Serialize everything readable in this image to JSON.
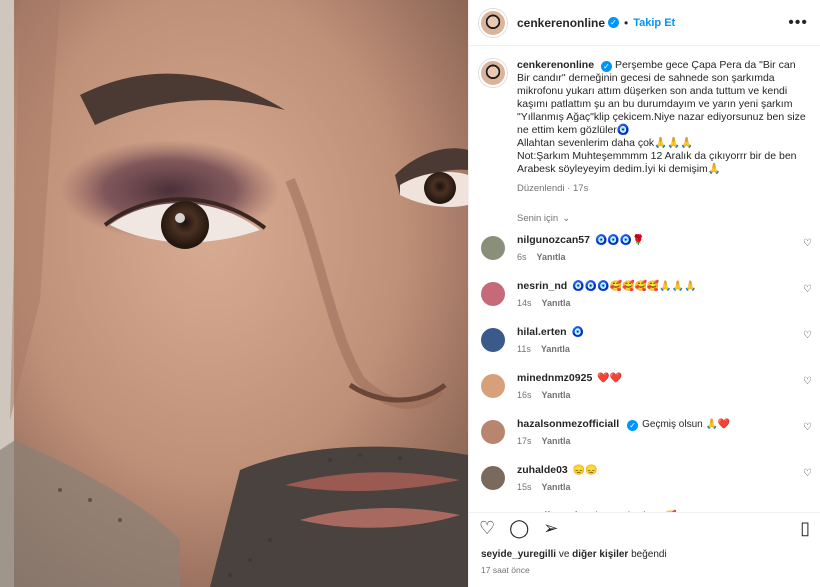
{
  "header": {
    "username": "cenkerenonline",
    "follow_label": "Takip Et",
    "more_label": "•••"
  },
  "caption": {
    "username": "cenkerenonline",
    "text": "Perşembe gece Çapa Pera da \"Bir can Bir candır\" derneğinin gecesi de sahnede son şarkımda mikrofonu yukarı attım düşerken son anda tuttum ve kendi kaşımı patlattım şu an bu durumdayım ve yarın yeni şarkım \"Yıllanmış Ağaç\"klip çekicem.Niye nazar ediyorsunuz ben size ne ettim kem gözlüler🧿",
    "line2": "Allahtan sevenlerim daha çok🙏🙏🙏",
    "line3": "Not:Şarkım Muhteşemmmm 12 Aralık da çıkıyorrr bir de ben Arabesk söyleyeyim dedim.İyi ki demişim🙏",
    "edited": "Düzenlendi",
    "age": "17s"
  },
  "for_you_label": "Senin için",
  "comments": [
    {
      "user": "nilgunozcan57",
      "text": "🧿🧿🧿🌹",
      "age": "6s",
      "reply": "Yanıtla",
      "color": "#8a8f7a"
    },
    {
      "user": "nesrin_nd",
      "text": "🧿🧿🧿🥰🥰🥰🥰🙏🙏🙏",
      "age": "14s",
      "reply": "Yanıtla",
      "color": "#c46a78"
    },
    {
      "user": "hilal.erten",
      "text": "🧿",
      "age": "11s",
      "reply": "Yanıtla",
      "color": "#3a5a8c"
    },
    {
      "user": "minednmz0925",
      "text": "❤️❤️",
      "age": "16s",
      "reply": "Yanıtla",
      "color": "#d8a07a"
    },
    {
      "user": "hazalsonmezofficiall",
      "text": "Geçmiş olsun 🙏❤️",
      "age": "17s",
      "reply": "Yanıtla",
      "color": "#b8866e"
    },
    {
      "user": "zuhalde03",
      "text": "😞😞",
      "age": "15s",
      "reply": "Yanıtla",
      "color": "#7a6a5e"
    },
    {
      "user": "tanselkutsal",
      "text": "Çok geçmiş olsun 🥰",
      "age": "",
      "reply": "",
      "color": "#5e5a52"
    }
  ],
  "liked_by": {
    "user": "seyide_yuregilli",
    "and": "ve",
    "others": "diğer kişiler",
    "suffix": "beğendi"
  },
  "post_time": "17 saat önce",
  "colors": {
    "accent": "#0095f6",
    "text": "#262626",
    "muted": "#737373"
  },
  "icons": [
    "heart-icon",
    "comment-icon",
    "share-icon",
    "bookmark-icon",
    "verified-icon",
    "more-icon"
  ]
}
